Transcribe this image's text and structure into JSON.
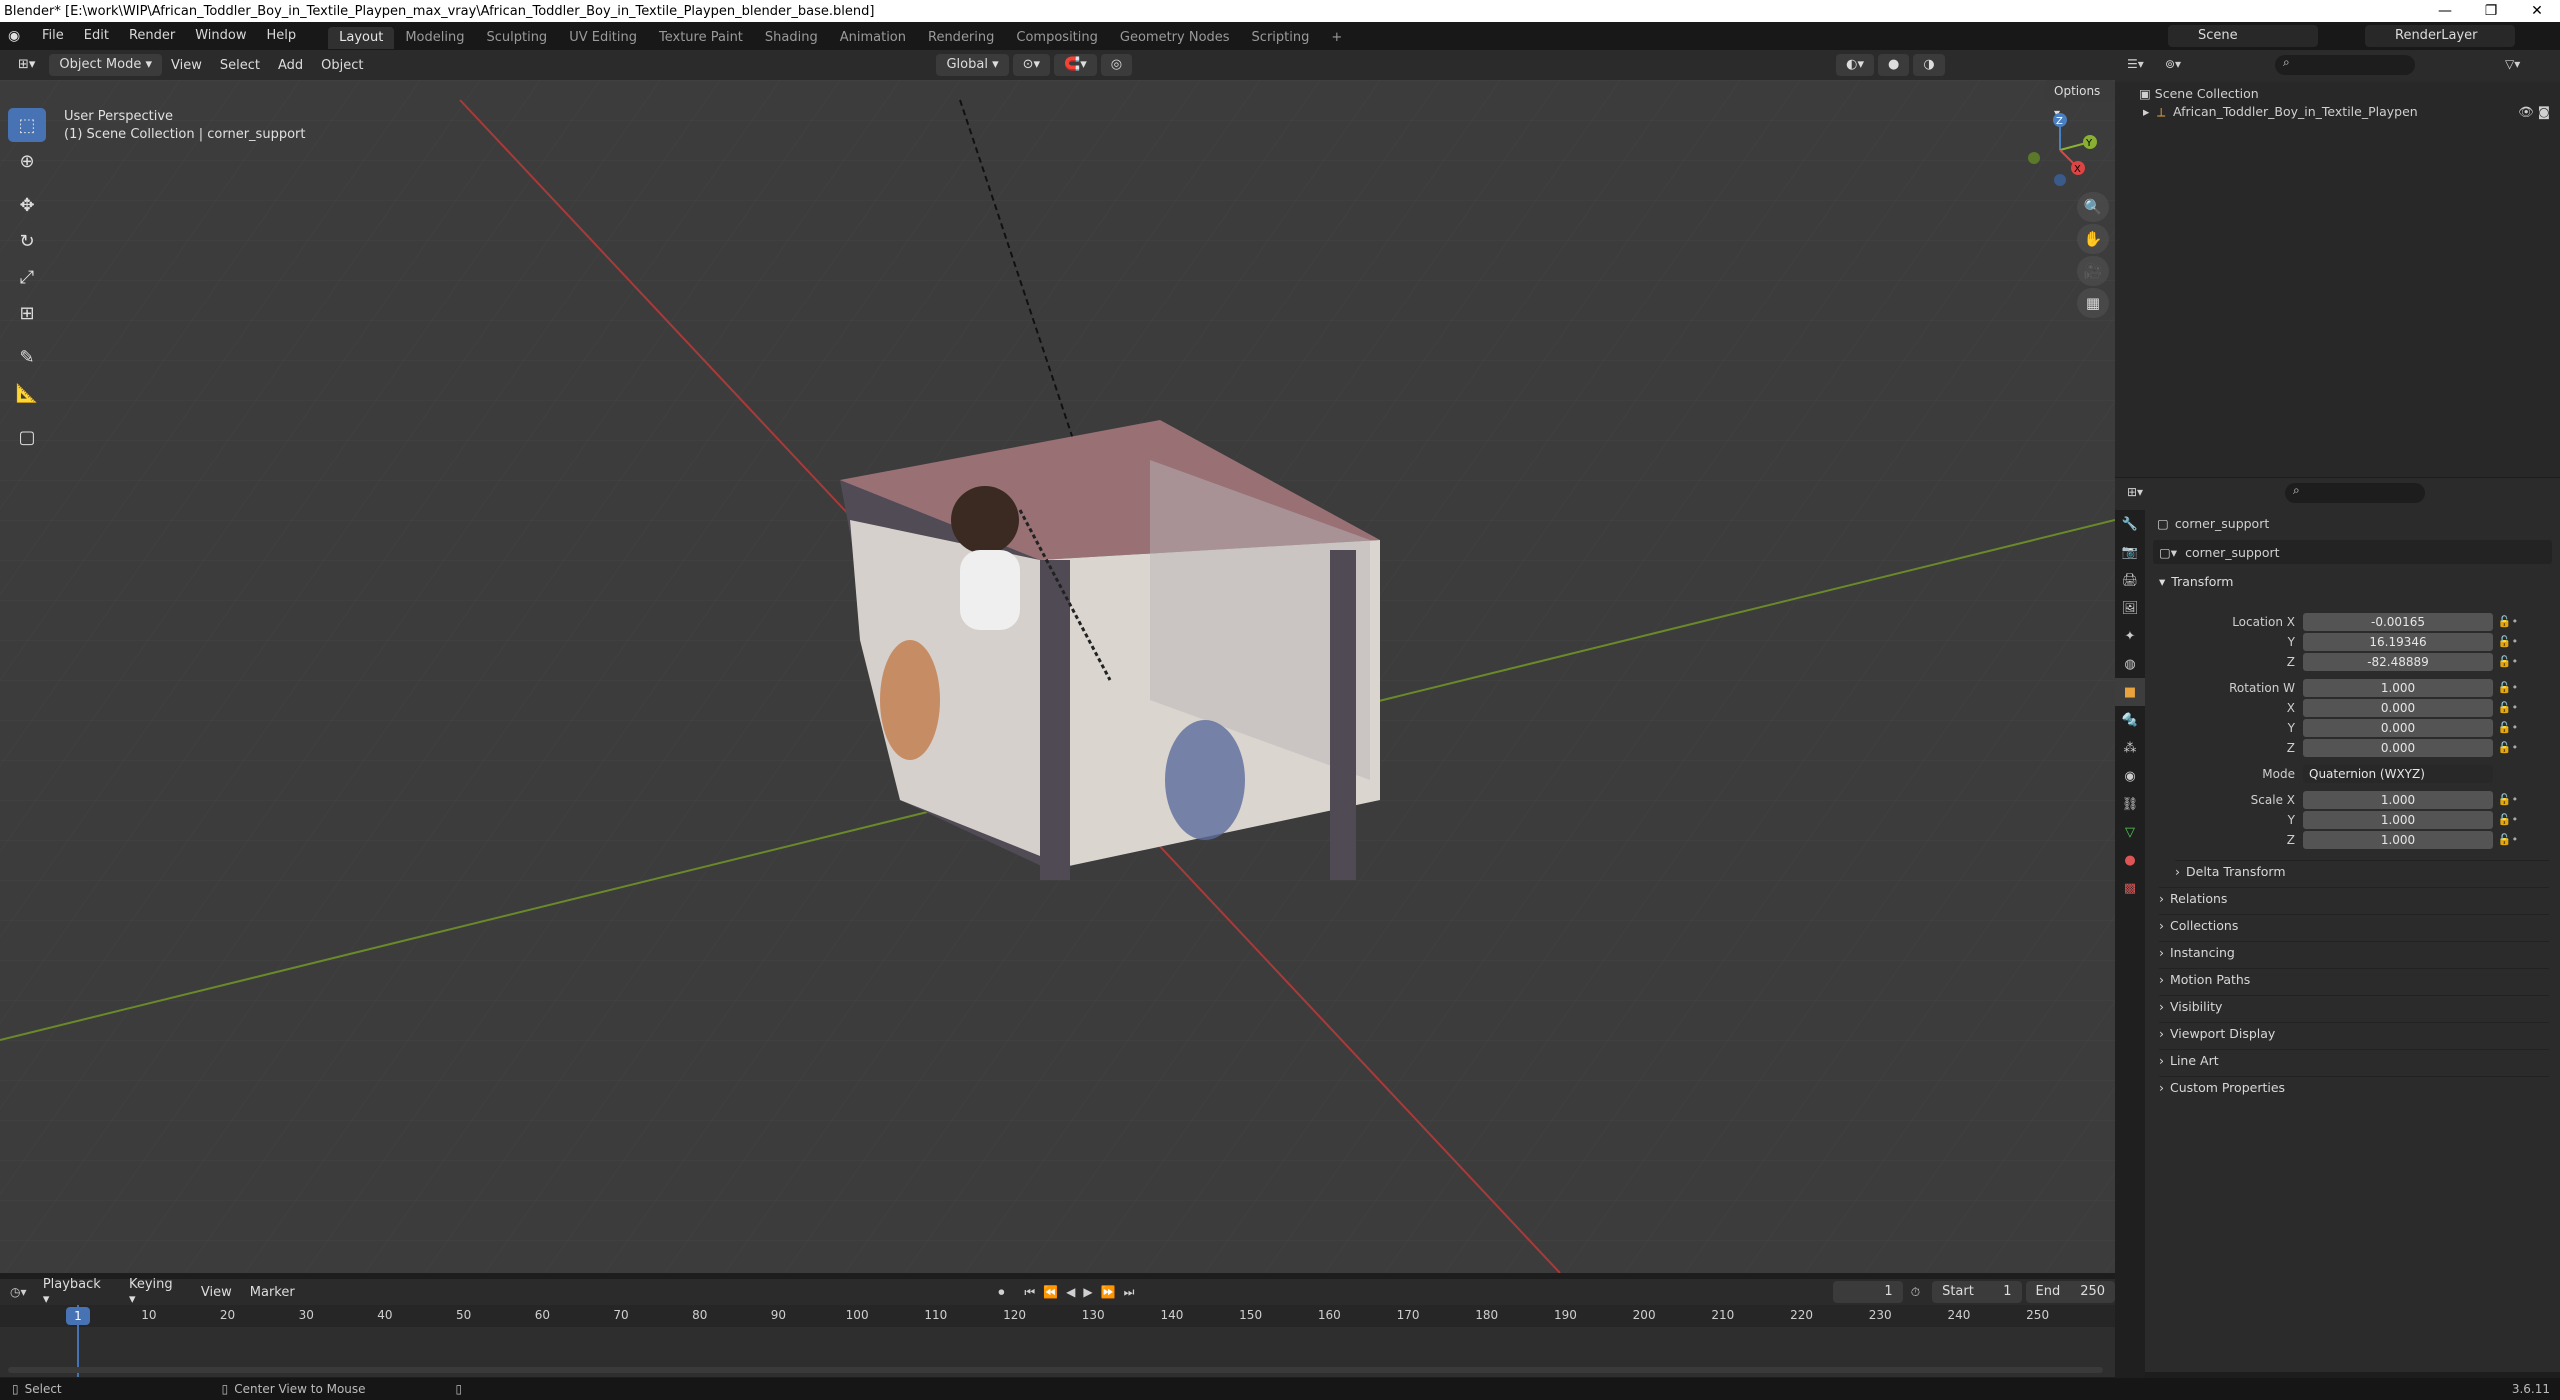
{
  "window": {
    "title": "Blender* [E:\\work\\WIP\\African_Toddler_Boy_in_Textile_Playpen_max_vray\\African_Toddler_Boy_in_Textile_Playpen_blender_base.blend]",
    "minimize": "—",
    "maximize": "❐",
    "close": "✕"
  },
  "menubar": {
    "items": [
      "File",
      "Edit",
      "Render",
      "Window",
      "Help"
    ],
    "workspaces": [
      "Layout",
      "Modeling",
      "Sculpting",
      "UV Editing",
      "Texture Paint",
      "Shading",
      "Animation",
      "Rendering",
      "Compositing",
      "Geometry Nodes",
      "Scripting"
    ],
    "add_tab": "+",
    "scene": "Scene",
    "view_layer": "RenderLayer"
  },
  "viewport_header": {
    "mode": "Object Mode",
    "menus": [
      "View",
      "Select",
      "Add",
      "Object"
    ],
    "transform_orientation": "Global",
    "options": "Options"
  },
  "viewport": {
    "perspective": "User Perspective",
    "collection_info": "(1) Scene Collection | corner_support",
    "axis_x": "X",
    "axis_y": "Y",
    "axis_z": "Z"
  },
  "outliner": {
    "root": "Scene Collection",
    "items": [
      "African_Toddler_Boy_in_Textile_Playpen"
    ]
  },
  "properties": {
    "object_name": "corner_support",
    "data_name": "corner_support",
    "transform_label": "Transform",
    "location_label": "Location X",
    "location": [
      "-0.00165",
      "16.19346",
      "-82.48889"
    ],
    "rotation_label": "Rotation W",
    "rotation": [
      "1.000",
      "0.000",
      "0.000",
      "0.000"
    ],
    "mode_label": "Mode",
    "mode_value": "Quaternion (WXYZ)",
    "scale_label": "Scale X",
    "scale": [
      "1.000",
      "1.000",
      "1.000"
    ],
    "axis_labels": [
      "Y",
      "Z",
      "X",
      "Y",
      "Z",
      "Y",
      "Z"
    ],
    "panels": [
      "Delta Transform",
      "Relations",
      "Collections",
      "Instancing",
      "Motion Paths",
      "Visibility",
      "Viewport Display",
      "Line Art",
      "Custom Properties"
    ]
  },
  "timeline": {
    "menus": [
      "Playback",
      "Keying",
      "View",
      "Marker"
    ],
    "current_frame": "1",
    "start_label": "Start",
    "start": "1",
    "end_label": "End",
    "end": "250",
    "ticks": [
      "1",
      "10",
      "20",
      "30",
      "40",
      "50",
      "60",
      "70",
      "80",
      "90",
      "100",
      "110",
      "120",
      "130",
      "140",
      "150",
      "160",
      "170",
      "180",
      "190",
      "200",
      "210",
      "220",
      "230",
      "240",
      "250"
    ]
  },
  "statusbar": {
    "select": "Select",
    "center_view": "Center View to Mouse",
    "version": "3.6.11"
  },
  "colors": {
    "accent": "#4772b3",
    "x_axis": "#a83a3a",
    "y_axis": "#6a8a2a",
    "grid": "#454545",
    "viewport_bg": "#3c3c3c"
  }
}
